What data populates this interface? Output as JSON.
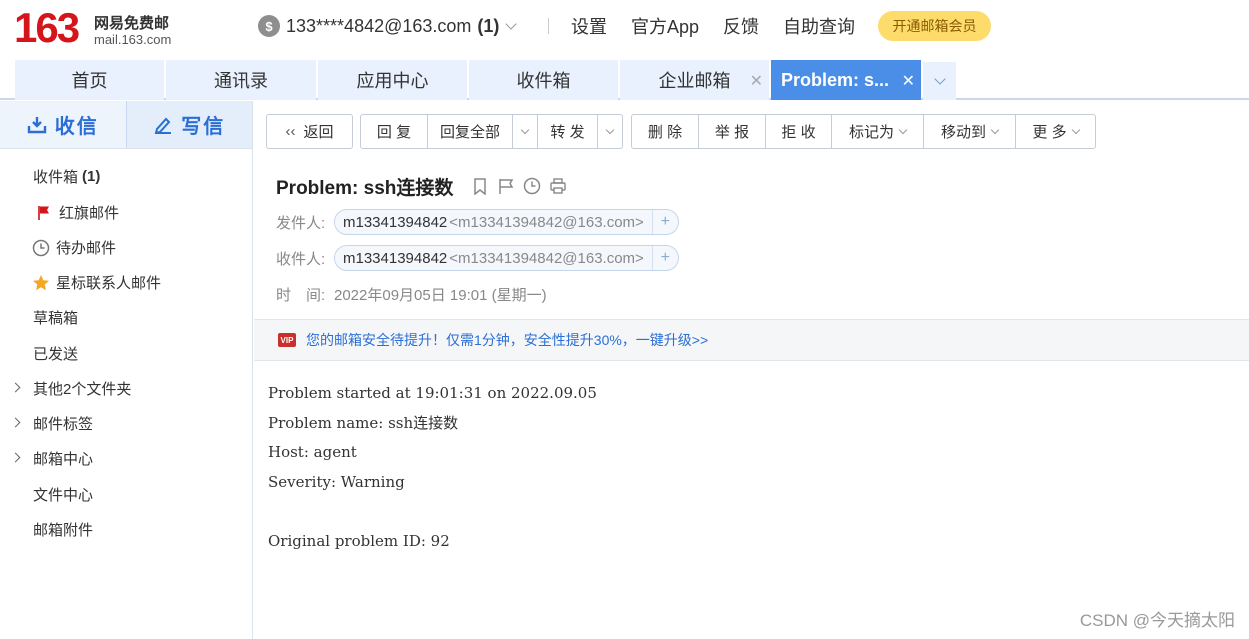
{
  "header": {
    "logo_number": "163",
    "logo_cn": "网易免费邮",
    "logo_domain": "mail.163.com",
    "account_email": "133****4842@163.com",
    "account_count": "(1)",
    "links": [
      "设置",
      "官方App",
      "反馈",
      "自助查询"
    ],
    "vip_button": "开通邮箱会员"
  },
  "tabs": [
    {
      "label": "首页"
    },
    {
      "label": "通讯录"
    },
    {
      "label": "应用中心"
    },
    {
      "label": "收件箱"
    },
    {
      "label": "企业邮箱"
    },
    {
      "label": "Problem: s..."
    }
  ],
  "sidebar": {
    "receive_label": "收信",
    "write_label": "写信",
    "folders": [
      {
        "label": "收件箱",
        "count": "(1)"
      },
      {
        "label": "红旗邮件"
      },
      {
        "label": "待办邮件"
      },
      {
        "label": "星标联系人邮件"
      },
      {
        "label": "草稿箱"
      },
      {
        "label": "已发送"
      },
      {
        "label": "其他2个文件夹"
      },
      {
        "label": "邮件标签"
      },
      {
        "label": "邮箱中心"
      },
      {
        "label": "文件中心"
      },
      {
        "label": "邮箱附件"
      }
    ]
  },
  "toolbar": {
    "back": "返回",
    "reply": "回 复",
    "reply_all": "回复全部",
    "forward": "转 发",
    "delete": "删 除",
    "report": "举 报",
    "reject": "拒 收",
    "mark_as": "标记为",
    "move_to": "移动到",
    "more": "更 多"
  },
  "email": {
    "subject": "Problem: ssh连接数",
    "from_label": "发件人:",
    "from_name": "m13341394842",
    "from_addr": "<m13341394842@163.com>",
    "to_label": "收件人:",
    "to_name": "m13341394842",
    "to_addr": "<m13341394842@163.com>",
    "time_label": "时　间:",
    "time_value": "2022年09月05日 19:01 (星期一)",
    "notice": "您的邮箱安全待提升！仅需1分钟，安全性提升30%，一键升级>>",
    "body_lines": [
      "Problem started at 19:01:31 on 2022.09.05",
      "Problem name: ssh连接数",
      "Host: agent",
      "Severity: Warning",
      "",
      "Original problem ID: 92"
    ]
  },
  "watermark": "CSDN @今天摘太阳"
}
